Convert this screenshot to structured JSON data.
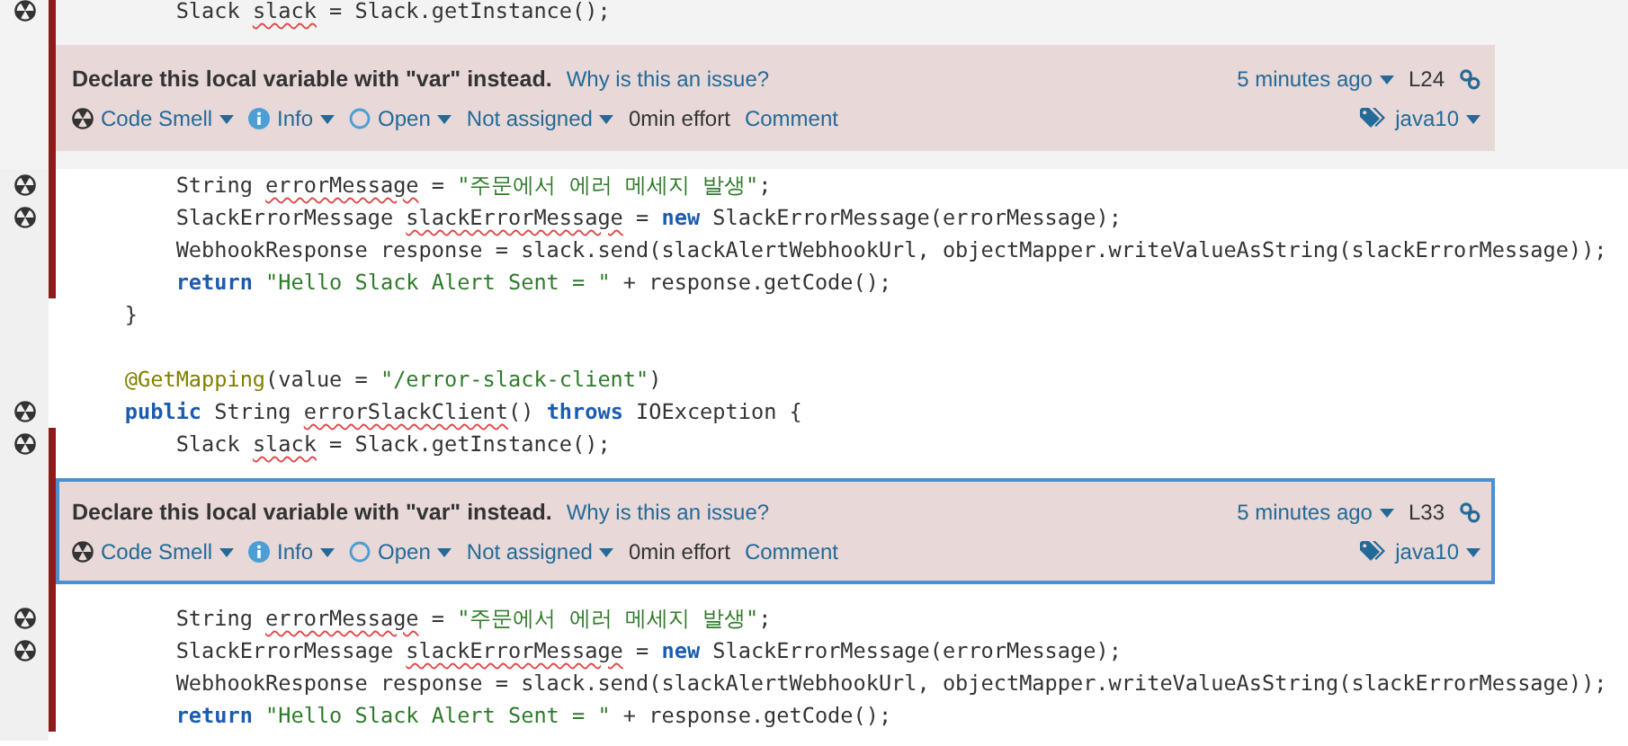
{
  "lines": [
    {
      "kind": "code",
      "gutter_icon": true,
      "marked": true,
      "hovered": true,
      "tokens": [
        {
          "text": "        Slack ",
          "kind": "plain"
        },
        {
          "text": "slack",
          "kind": "flagged"
        },
        {
          "text": " = Slack.getInstance();",
          "kind": "plain"
        }
      ]
    },
    {
      "kind": "issue",
      "marked": true,
      "hovered": true,
      "selected": false,
      "message": "Declare this local variable with \"var\" instead.",
      "why_link": "Why is this an issue?",
      "age": "5 minutes ago",
      "line": "L24",
      "type": "Code Smell",
      "severity": "Info",
      "status": "Open",
      "assignee": "Not assigned",
      "effort": "0min effort",
      "comment": "Comment",
      "tag": "java10"
    },
    {
      "kind": "code",
      "gutter_icon": true,
      "marked": true,
      "hovered": false,
      "tokens": [
        {
          "text": "        String ",
          "kind": "plain"
        },
        {
          "text": "errorMessage",
          "kind": "flagged"
        },
        {
          "text": " = ",
          "kind": "plain"
        },
        {
          "text": "\"주문에서 에러 메세지 발생\"",
          "kind": "string"
        },
        {
          "text": ";",
          "kind": "plain"
        }
      ]
    },
    {
      "kind": "code",
      "gutter_icon": true,
      "marked": true,
      "hovered": false,
      "tokens": [
        {
          "text": "        SlackErrorMessage ",
          "kind": "plain"
        },
        {
          "text": "slackErrorMessage",
          "kind": "flagged"
        },
        {
          "text": " = ",
          "kind": "plain"
        },
        {
          "text": "new",
          "kind": "keyword"
        },
        {
          "text": " SlackErrorMessage(errorMessage);",
          "kind": "plain"
        }
      ]
    },
    {
      "kind": "code",
      "gutter_icon": false,
      "marked": true,
      "hovered": false,
      "tokens": [
        {
          "text": "        WebhookResponse response = slack.send(slackAlertWebhookUrl, objectMapper.writeValueAsString(slackErrorMessage));",
          "kind": "plain"
        }
      ]
    },
    {
      "kind": "code",
      "gutter_icon": false,
      "marked": true,
      "hovered": false,
      "tokens": [
        {
          "text": "        return",
          "kind": "keyword"
        },
        {
          "text": " \"Hello Slack Alert Sent = \"",
          "kind": "string"
        },
        {
          "text": " + response.getCode();",
          "kind": "plain"
        }
      ]
    },
    {
      "kind": "code",
      "gutter_icon": false,
      "marked": false,
      "hovered": false,
      "tokens": [
        {
          "text": "    }",
          "kind": "plain"
        }
      ]
    },
    {
      "kind": "blank",
      "marked": false
    },
    {
      "kind": "code",
      "gutter_icon": false,
      "marked": false,
      "hovered": false,
      "tokens": [
        {
          "text": "    @GetMapping",
          "kind": "annotation"
        },
        {
          "text": "(value = ",
          "kind": "plain"
        },
        {
          "text": "\"/error-slack-client\"",
          "kind": "string"
        },
        {
          "text": ")",
          "kind": "plain"
        }
      ]
    },
    {
      "kind": "code",
      "gutter_icon": true,
      "marked": false,
      "hovered": false,
      "tokens": [
        {
          "text": "    public",
          "kind": "keyword"
        },
        {
          "text": " String ",
          "kind": "plain"
        },
        {
          "text": "errorSlackClient",
          "kind": "flagged"
        },
        {
          "text": "() ",
          "kind": "plain"
        },
        {
          "text": "throws",
          "kind": "keyword"
        },
        {
          "text": " IOException {",
          "kind": "plain"
        }
      ]
    },
    {
      "kind": "code",
      "gutter_icon": true,
      "marked": true,
      "hovered": false,
      "tokens": [
        {
          "text": "        Slack ",
          "kind": "plain"
        },
        {
          "text": "slack",
          "kind": "flagged"
        },
        {
          "text": " = Slack.getInstance();",
          "kind": "plain"
        }
      ]
    },
    {
      "kind": "issue",
      "marked": true,
      "hovered": false,
      "selected": true,
      "message": "Declare this local variable with \"var\" instead.",
      "why_link": "Why is this an issue?",
      "age": "5 minutes ago",
      "line": "L33",
      "type": "Code Smell",
      "severity": "Info",
      "status": "Open",
      "assignee": "Not assigned",
      "effort": "0min effort",
      "comment": "Comment",
      "tag": "java10"
    },
    {
      "kind": "code",
      "gutter_icon": true,
      "marked": true,
      "hovered": false,
      "tokens": [
        {
          "text": "        String ",
          "kind": "plain"
        },
        {
          "text": "errorMessage",
          "kind": "flagged"
        },
        {
          "text": " = ",
          "kind": "plain"
        },
        {
          "text": "\"주문에서 에러 메세지 발생\"",
          "kind": "string"
        },
        {
          "text": ";",
          "kind": "plain"
        }
      ]
    },
    {
      "kind": "code",
      "gutter_icon": true,
      "marked": true,
      "hovered": false,
      "tokens": [
        {
          "text": "        SlackErrorMessage ",
          "kind": "plain"
        },
        {
          "text": "slackErrorMessage",
          "kind": "flagged"
        },
        {
          "text": " = ",
          "kind": "plain"
        },
        {
          "text": "new",
          "kind": "keyword"
        },
        {
          "text": " SlackErrorMessage(errorMessage);",
          "kind": "plain"
        }
      ]
    },
    {
      "kind": "code",
      "gutter_icon": false,
      "marked": true,
      "hovered": false,
      "tokens": [
        {
          "text": "        WebhookResponse response = slack.send(slackAlertWebhookUrl, objectMapper.writeValueAsString(slackErrorMessage));",
          "kind": "plain"
        }
      ]
    },
    {
      "kind": "code",
      "gutter_icon": false,
      "marked": true,
      "hovered": false,
      "tokens": [
        {
          "text": "        return",
          "kind": "keyword"
        },
        {
          "text": " \"Hello Slack Alert Sent = \"",
          "kind": "string"
        },
        {
          "text": " + response.getCode();",
          "kind": "plain"
        }
      ]
    }
  ]
}
